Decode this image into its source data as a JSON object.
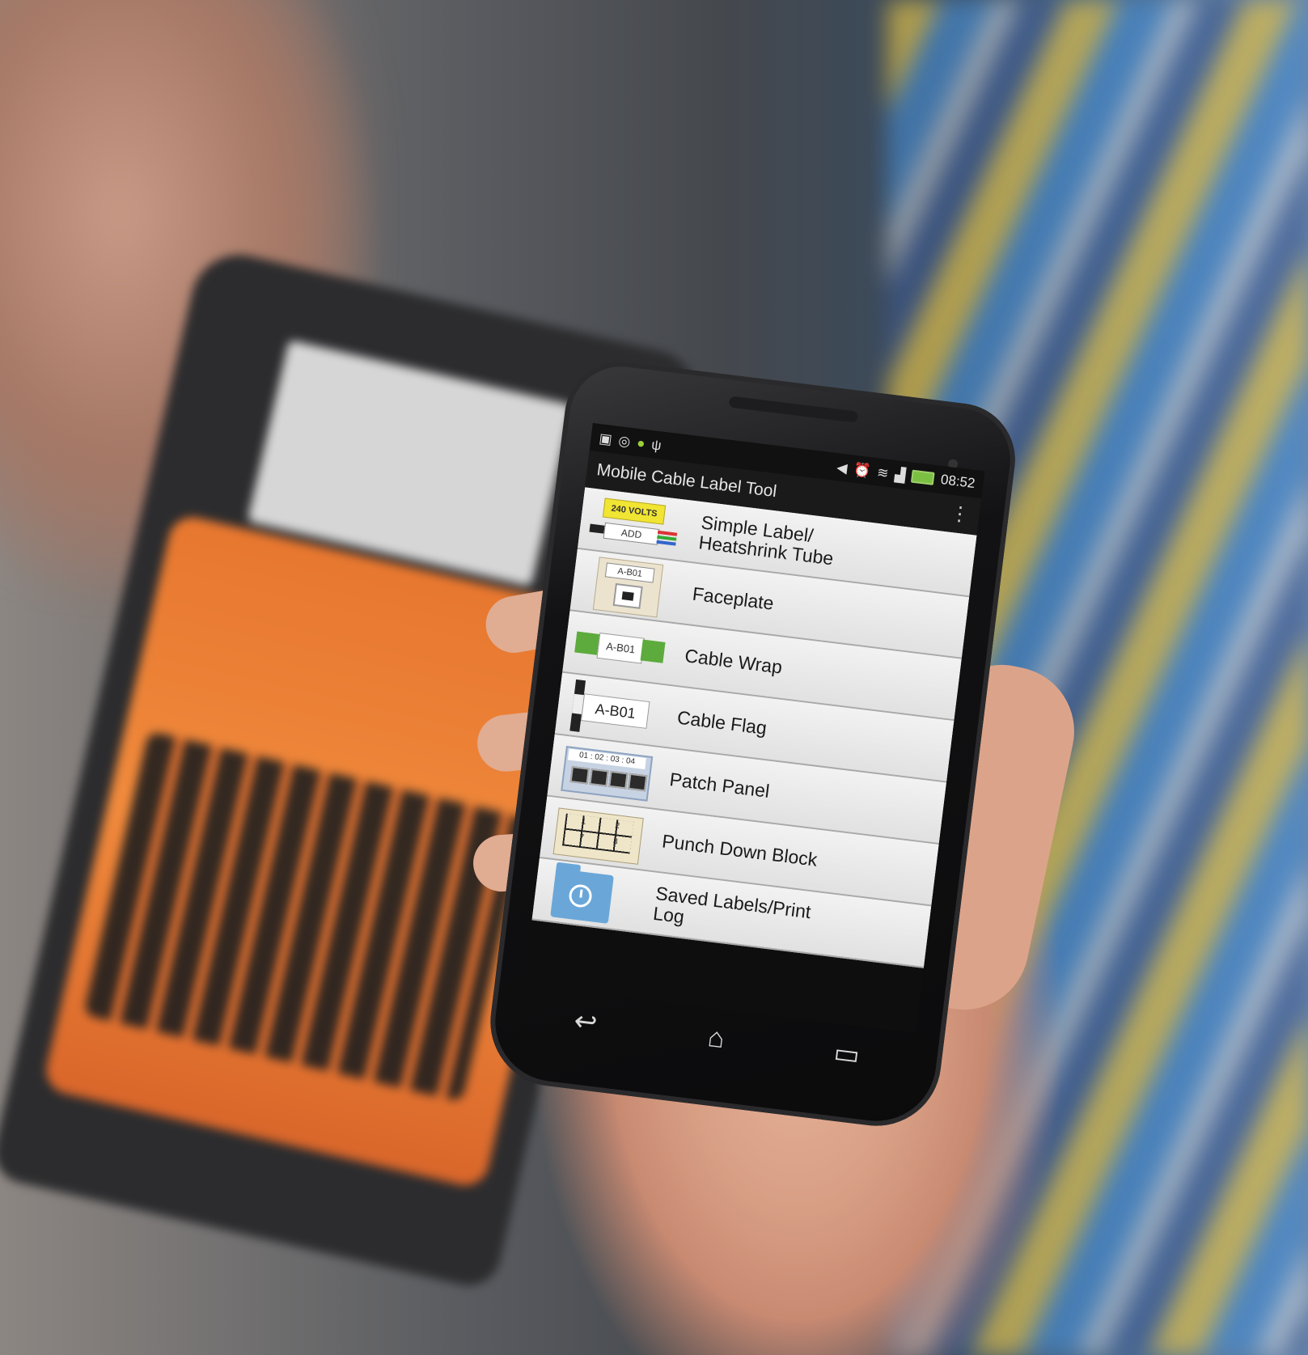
{
  "status_bar": {
    "left_icons": [
      "image-icon",
      "whatsapp-icon",
      "android-icon",
      "usb-icon"
    ],
    "right_icons": [
      "volume-icon",
      "alarm-icon",
      "wifi-icon",
      "signal-icon",
      "battery-icon"
    ],
    "time": "08:52"
  },
  "action_bar": {
    "title": "Mobile Cable Label Tool",
    "overflow_icon": "⋮"
  },
  "menu": {
    "items": [
      {
        "label": "Simple Label/\nHeatshrink Tube",
        "thumb_text": [
          "240 VOLTS",
          "ADD"
        ]
      },
      {
        "label": "Faceplate",
        "thumb_text": [
          "A-B01"
        ]
      },
      {
        "label": "Cable Wrap",
        "thumb_text": [
          "A-B01"
        ]
      },
      {
        "label": "Cable Flag",
        "thumb_text": [
          "A-B01"
        ]
      },
      {
        "label": "Patch Panel",
        "thumb_text": [
          "01 : 02 : 03 : 04"
        ]
      },
      {
        "label": "Punch Down Block",
        "thumb_text": [
          "1",
          "2",
          "7",
          "8"
        ]
      },
      {
        "label": "Saved Labels/Print\nLog",
        "thumb_text": []
      }
    ]
  },
  "nav_bar": {
    "back_icon": "↩",
    "home_icon": "⌂",
    "recents_icon": "▭"
  },
  "colors": {
    "printer_orange": "#e7772f",
    "label_yellow": "#f1e533",
    "wrap_green": "#5cab3c",
    "folder_blue": "#6aa7d8",
    "battery_green": "#7bc043"
  }
}
